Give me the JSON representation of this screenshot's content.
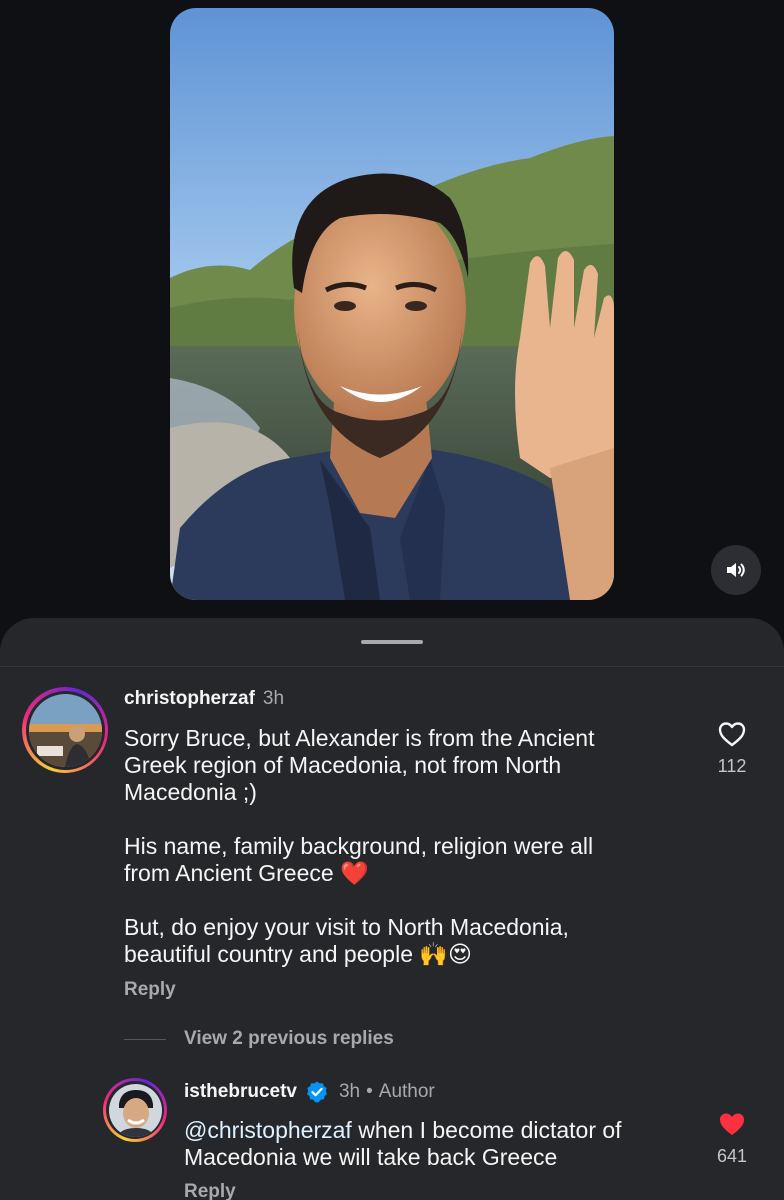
{
  "video": {
    "sound_icon": "speaker-icon"
  },
  "comments": [
    {
      "username": "christopherzaf",
      "time": "3h",
      "lines": [
        "Sorry Bruce, but Alexander is from the Ancient",
        "Greek region of Macedonia, not from North",
        "Macedonia ;)"
      ],
      "para2_lines": [
        "His name, family background, religion were all",
        "from Ancient Greece ❤️"
      ],
      "para3_lines": [
        "But, do enjoy your visit to North Macedonia,",
        "beautiful country and people 🙌😍"
      ],
      "reply_label": "Reply",
      "like_count": "112",
      "liked": false
    }
  ],
  "view_replies_label": "View 2 previous replies",
  "reply": {
    "username": "isthebrucetv",
    "verified_icon": "verified-badge-icon",
    "time": "3h",
    "separator": "•",
    "author_label": "Author",
    "mention": "@christopherzaf",
    "text_line1_rest": " when I become dictator of",
    "text_line2": "Macedonia we will take back Greece",
    "reply_label": "Reply",
    "like_count": "641",
    "liked": true
  },
  "colors": {
    "background": "#0f1013",
    "sheet": "#25272b",
    "like_red": "#ff3040",
    "verified_blue": "#0095f6",
    "muted_text": "#a8a9ad"
  }
}
